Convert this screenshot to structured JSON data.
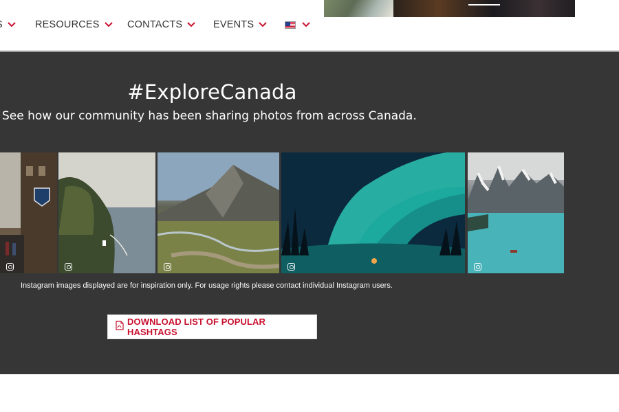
{
  "nav": {
    "items": [
      {
        "label": "S"
      },
      {
        "label": "RESOURCES"
      },
      {
        "label": "CONTACTS"
      },
      {
        "label": "EVENTS"
      }
    ],
    "language": {
      "icon": "us-flag-icon"
    },
    "accent": "#c8102e"
  },
  "explore": {
    "title": "#ExploreCanada",
    "subtitle": "See how our community has been sharing photos from across Canada.",
    "photos": [
      {
        "icon": "instagram-icon"
      },
      {
        "icon": "instagram-icon"
      },
      {
        "icon": "instagram-icon"
      },
      {
        "icon": "instagram-icon"
      },
      {
        "icon": "instagram-icon"
      }
    ],
    "disclaimer": "Instagram images displayed are for inspiration only. For usage rights please contact individual Instagram users.",
    "download": {
      "label": "DOWNLOAD LIST OF POPULAR HASHTAGS",
      "icon": "pdf-icon"
    },
    "background": "#363636"
  }
}
